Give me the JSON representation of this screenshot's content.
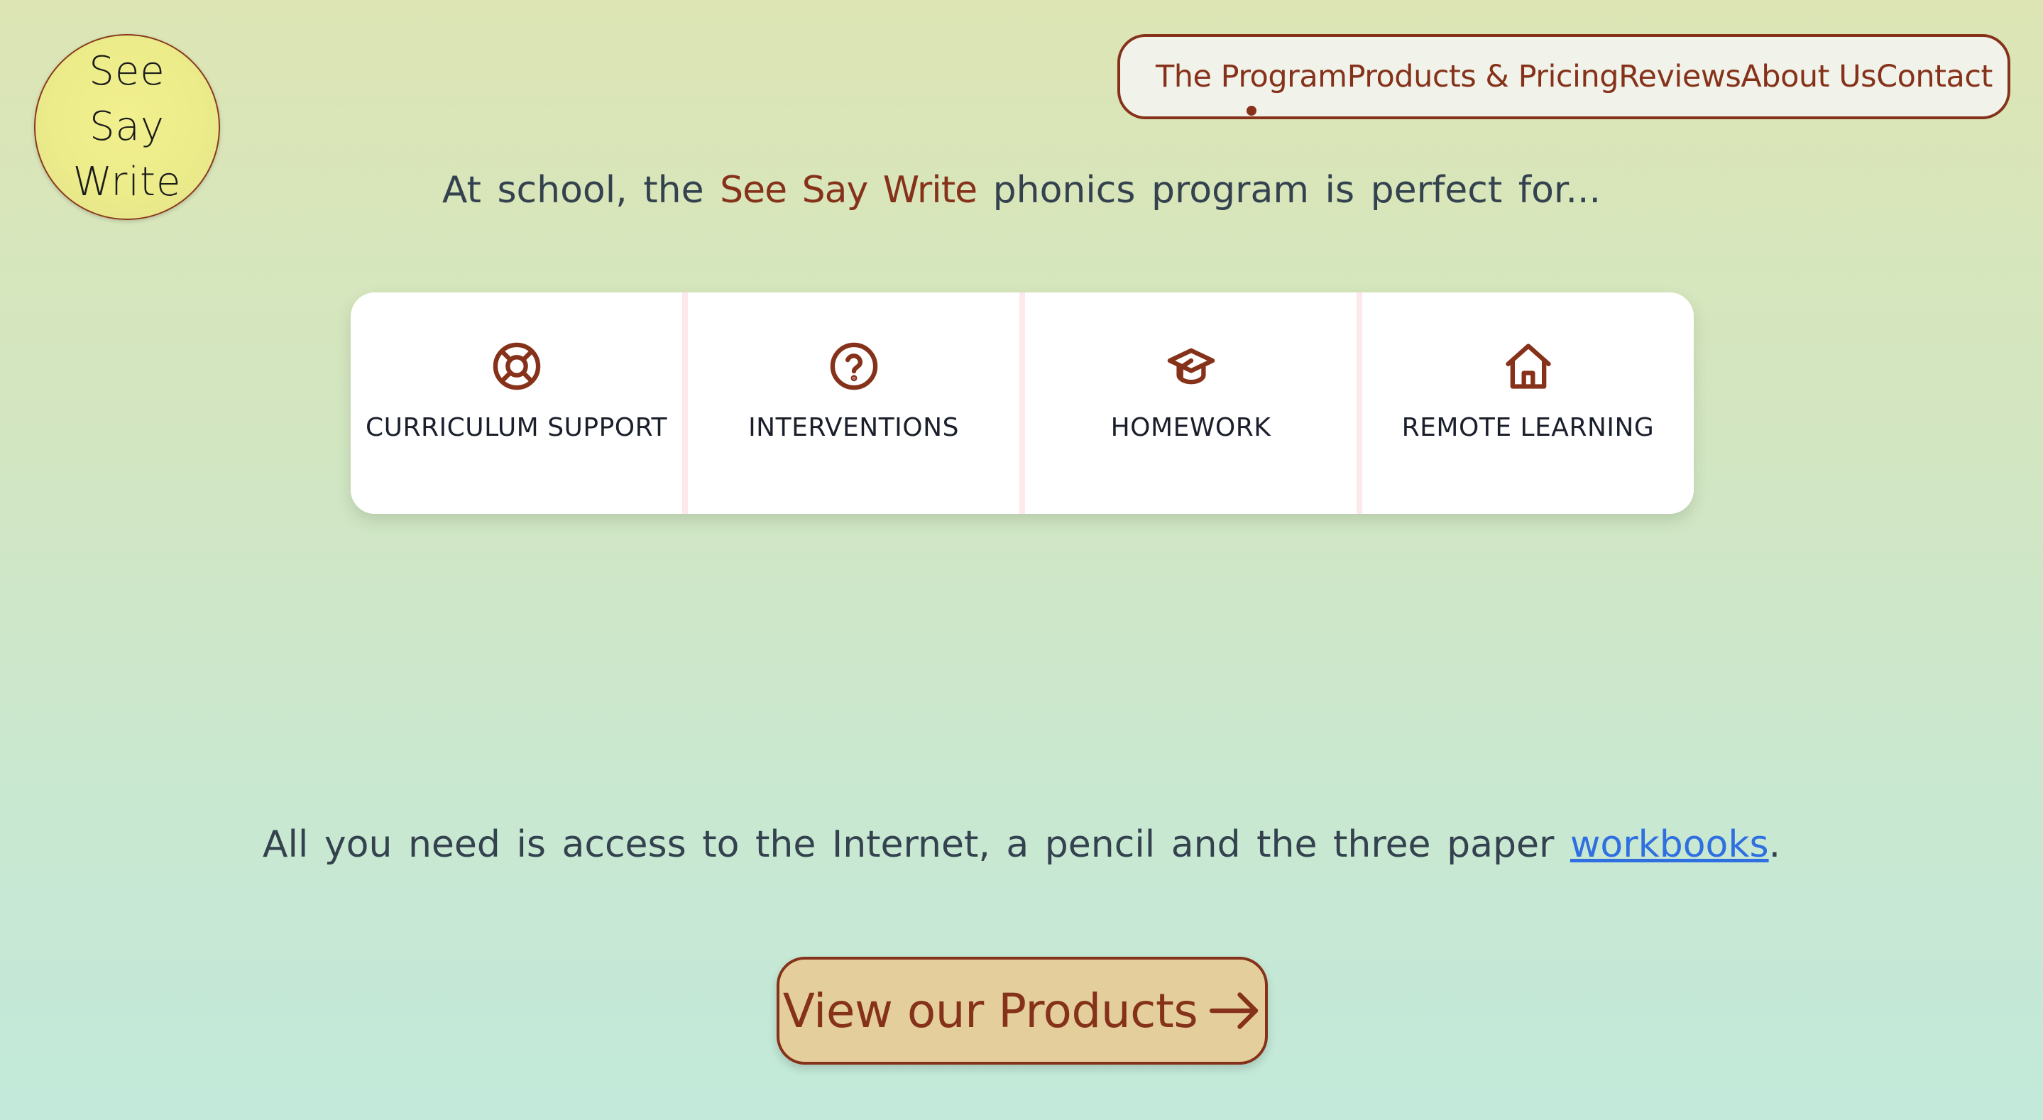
{
  "colors": {
    "brand_brown": "#86321a",
    "link_blue": "#2f6fe0",
    "logo_yellow": "#ecec8a",
    "cta_tan": "#e4cf9c",
    "card_white": "#ffffff",
    "card_divider_pink": "#fde8ec"
  },
  "logo": {
    "line1": "See",
    "line2": "Say",
    "line3": "Write"
  },
  "nav": {
    "items": [
      {
        "label": "The Program",
        "active": true
      },
      {
        "label": "Products & Pricing",
        "active": false
      },
      {
        "label": "Reviews",
        "active": false
      },
      {
        "label": "About Us",
        "active": false
      },
      {
        "label": "Contact",
        "active": false
      }
    ]
  },
  "intro": {
    "before": "At school, the ",
    "brand": "See Say Write",
    "after": " phonics program is perfect for..."
  },
  "features": [
    {
      "label": "CURRICULUM SUPPORT",
      "icon": "lifebuoy-icon"
    },
    {
      "label": "INTERVENTIONS",
      "icon": "question-circle-icon"
    },
    {
      "label": "HOMEWORK",
      "icon": "graduation-cap-icon"
    },
    {
      "label": "REMOTE LEARNING",
      "icon": "home-icon"
    }
  ],
  "requirements": {
    "before": "All you need is access to the Internet, a pencil and the three paper ",
    "link": "workbooks",
    "after": "."
  },
  "cta": {
    "label": "View our Products",
    "icon": "arrow-right-icon"
  }
}
